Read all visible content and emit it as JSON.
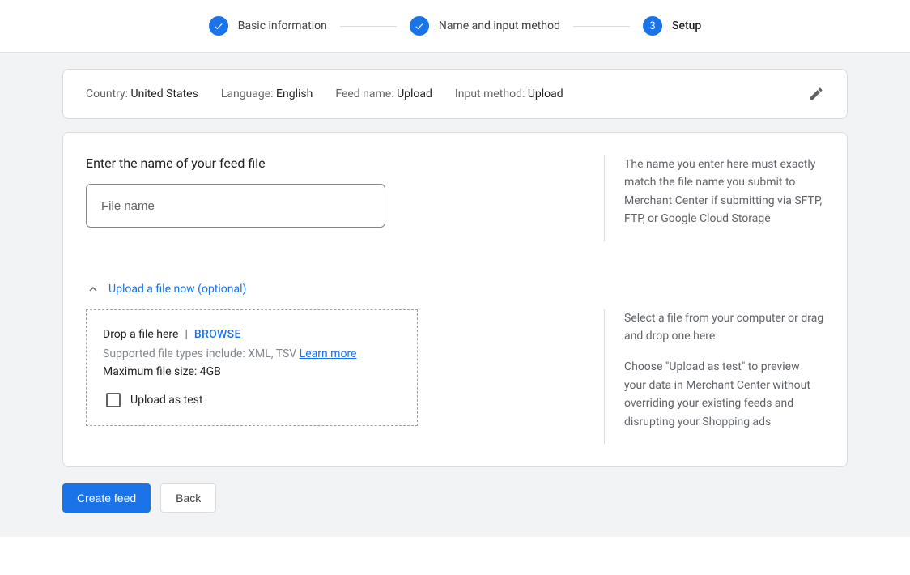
{
  "stepper": {
    "step1": "Basic information",
    "step2": "Name and input method",
    "step3": "Setup",
    "step3_number": "3"
  },
  "summary": {
    "country_label": "Country: ",
    "country_value": "United States",
    "language_label": "Language: ",
    "language_value": "English",
    "feedname_label": "Feed name: ",
    "feedname_value": "Upload",
    "inputmethod_label": "Input method: ",
    "inputmethod_value": "Upload"
  },
  "main": {
    "title": "Enter the name of your feed file",
    "placeholder": "File name",
    "help_filename": "The name you enter here must exactly match the file name you submit to Merchant Center if submitting via SFTP, FTP, or Google Cloud Storage",
    "expander_label": "Upload a file now (optional)",
    "drop_text": "Drop a file here",
    "drop_divider": "|",
    "browse_text": "BROWSE",
    "supported_text": "Supported file types include: XML, TSV ",
    "learn_more": "Learn more",
    "max_size": "Maximum file size: 4GB",
    "upload_as_test": "Upload as test",
    "help_select_file": "Select a file from your computer or drag and drop one here",
    "help_upload_test": "Choose \"Upload as test\" to preview your data in Merchant Center without overriding your existing feeds and disrupting your Shopping ads"
  },
  "buttons": {
    "create": "Create feed",
    "back": "Back"
  }
}
